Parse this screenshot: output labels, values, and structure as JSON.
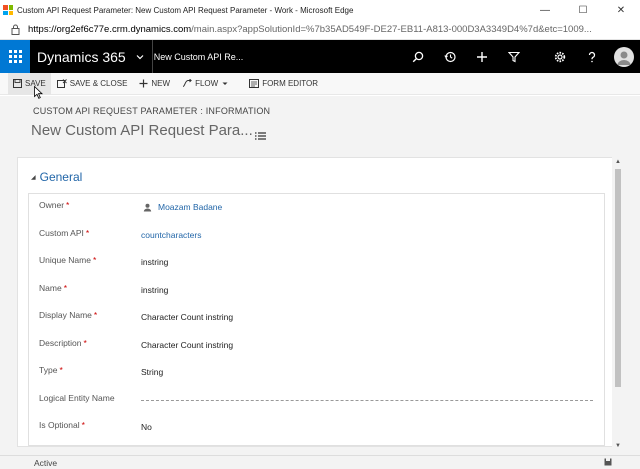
{
  "browser": {
    "title": "Custom API Request Parameter: New Custom API Request Parameter - Work - Microsoft Edge",
    "url_host": "https://org2ef6c77e.crm.dynamics.com",
    "url_rest": "/main.aspx?appSolutionId=%7b35AD549F-DE27-EB11-A813-000D3A3349D4%7d&etc=1009...",
    "minimize_glyph": "—",
    "maximize_glyph": "☐",
    "close_glyph": "✕"
  },
  "navbar": {
    "brand": "Dynamics 365",
    "entity": "New Custom API Re..."
  },
  "commands": {
    "save": "SAVE",
    "save_close": "SAVE & CLOSE",
    "new": "NEW",
    "flow": "FLOW",
    "form_editor": "FORM EDITOR"
  },
  "header": {
    "entity_label": "CUSTOM API REQUEST PARAMETER : INFORMATION",
    "record_title": "New Custom API Request Para..."
  },
  "section": {
    "title": "General",
    "collapse_glyph": "◢"
  },
  "fields": [
    {
      "label": "Owner",
      "required": "*",
      "value": "Moazam Badane",
      "kind": "user"
    },
    {
      "label": "Custom API",
      "required": "*",
      "value": "countcharacters",
      "kind": "link"
    },
    {
      "label": "Unique Name",
      "required": "*",
      "value": "instring",
      "kind": "text"
    },
    {
      "label": "Name",
      "required": "*",
      "value": "instring",
      "kind": "text"
    },
    {
      "label": "Display Name",
      "required": "*",
      "value": "Character Count instring",
      "kind": "text"
    },
    {
      "label": "Description",
      "required": "*",
      "value": "Character Count instring",
      "kind": "text"
    },
    {
      "label": "Type",
      "required": "*",
      "value": "String",
      "kind": "text"
    },
    {
      "label": "Logical Entity Name",
      "required": "",
      "value": "",
      "kind": "empty"
    },
    {
      "label": "Is Optional",
      "required": "*",
      "value": "No",
      "kind": "text"
    }
  ],
  "scroll": {
    "up_glyph": "▲",
    "down_glyph": "▼"
  },
  "footer": {
    "status": "Active"
  },
  "colors": {
    "accent": "#0078d4",
    "link": "#2266a8",
    "required": "#cc0000",
    "navbar": "#000000"
  }
}
